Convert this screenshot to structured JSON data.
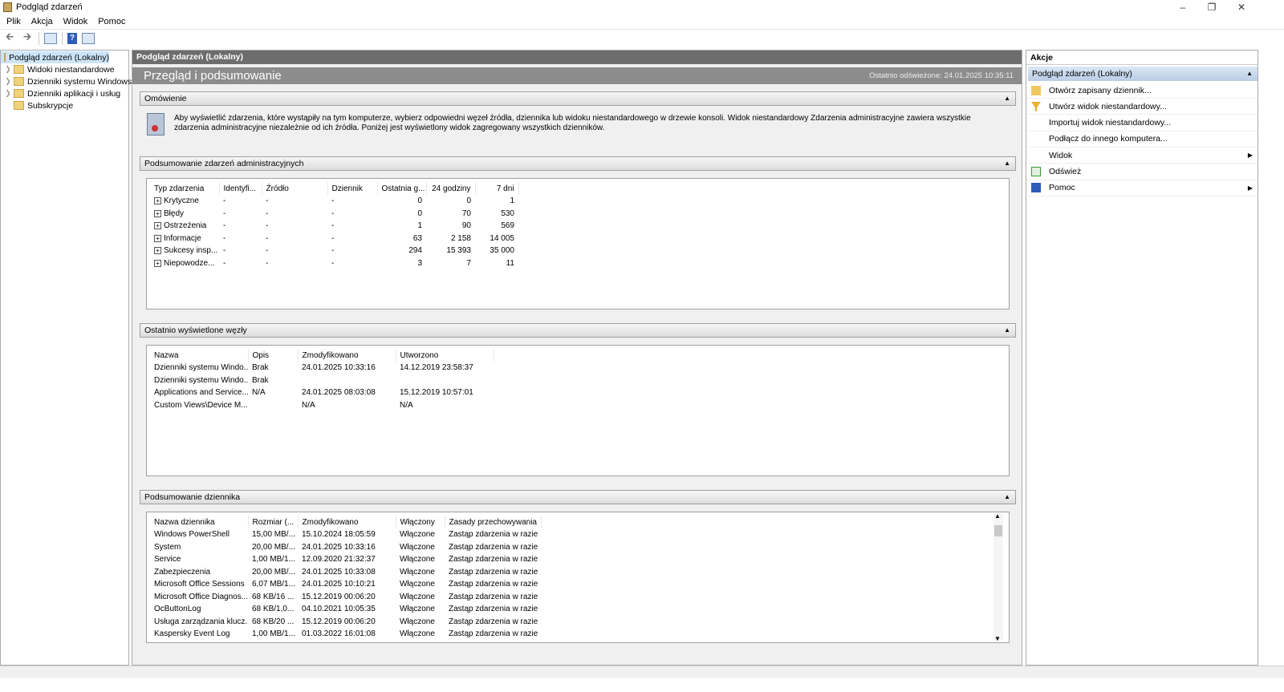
{
  "window": {
    "title": "Podgląd zdarzeń"
  },
  "menu": [
    "Plik",
    "Akcja",
    "Widok",
    "Pomoc"
  ],
  "tree": [
    {
      "label": "Podgląd zdarzeń (Lokalny)"
    },
    {
      "label": "Widoki niestandardowe"
    },
    {
      "label": "Dzienniki systemu Windows"
    },
    {
      "label": "Dzienniki aplikacji i usług"
    },
    {
      "label": "Subskrypcje"
    }
  ],
  "center": {
    "header": "Podgląd zdarzeń (Lokalny)",
    "title": "Przegląd i podsumowanie",
    "refreshed": "Ostatnio odświeżone: 24.01.2025 10:35:11",
    "overview": {
      "title": "Omówienie",
      "text": "Aby wyświetlić zdarzenia, które wystąpiły na tym komputerze, wybierz odpowiedni węzeł źródła, dziennika lub widoku niestandardowego w drzewie konsoli. Widok niestandardowy Zdarzenia administracyjne zawiera wszystkie zdarzenia administracyjne niezależnie od ich źródła. Poniżej jest wyświetlony widok zagregowany wszystkich dzienników."
    },
    "admin": {
      "title": "Podsumowanie zdarzeń administracyjnych",
      "columns": [
        "Typ zdarzenia",
        "Identyfi...",
        "Źródło",
        "Dziennik",
        "Ostatnia g...",
        "24 godziny",
        "7 dni"
      ],
      "rows": [
        [
          "Krytyczne",
          "-",
          "-",
          "-",
          "0",
          "0",
          "1"
        ],
        [
          "Błędy",
          "-",
          "-",
          "-",
          "0",
          "70",
          "530"
        ],
        [
          "Ostrzeżenia",
          "-",
          "-",
          "-",
          "1",
          "90",
          "569"
        ],
        [
          "Informacje",
          "-",
          "-",
          "-",
          "63",
          "2 158",
          "14 005"
        ],
        [
          "Sukcesy insp...",
          "-",
          "-",
          "-",
          "294",
          "15 393",
          "35 000"
        ],
        [
          "Niepowodze...",
          "-",
          "-",
          "-",
          "3",
          "7",
          "11"
        ]
      ]
    },
    "recent": {
      "title": "Ostatnio wyświetlone węzły",
      "columns": [
        "Nazwa",
        "Opis",
        "Zmodyfikowano",
        "Utworzono"
      ],
      "rows": [
        [
          "Dzienniki systemu Windo...",
          "Brak",
          "24.01.2025 10:33:16",
          "14.12.2019 23:58:37"
        ],
        [
          "Dzienniki systemu Windo...",
          "Brak",
          "",
          ""
        ],
        [
          "Applications and Service...",
          "N/A",
          "24.01.2025 08:03:08",
          "15.12.2019 10:57:01"
        ],
        [
          "Custom Views\\Device M...",
          "",
          "N/A",
          "N/A"
        ]
      ]
    },
    "logs": {
      "title": "Podsumowanie dziennika",
      "columns": [
        "Nazwa dziennika",
        "Rozmiar (...",
        "Zmodyfikowano",
        "Włączony",
        "Zasady przechowywania"
      ],
      "rows": [
        [
          "Windows PowerShell",
          "15,00 MB/...",
          "15.10.2024 18:05:59",
          "Włączone",
          "Zastąp zdarzenia w razie ..."
        ],
        [
          "System",
          "20,00 MB/...",
          "24.01.2025 10:33:16",
          "Włączone",
          "Zastąp zdarzenia w razie ..."
        ],
        [
          "Service",
          "1,00 MB/1...",
          "12.09.2020 21:32:37",
          "Włączone",
          "Zastąp zdarzenia w razie ..."
        ],
        [
          "Zabezpieczenia",
          "20,00 MB/...",
          "24.01.2025 10:33:08",
          "Włączone",
          "Zastąp zdarzenia w razie ..."
        ],
        [
          "Microsoft Office Sessions",
          "6,07 MB/1...",
          "24.01.2025 10:10:21",
          "Włączone",
          "Zastąp zdarzenia w razie ..."
        ],
        [
          "Microsoft Office Diagnos...",
          "68 KB/16 ...",
          "15.12.2019 00:06:20",
          "Włączone",
          "Zastąp zdarzenia w razie ..."
        ],
        [
          "OcButtonLog",
          "68 KB/1,0...",
          "04.10.2021 10:05:35",
          "Włączone",
          "Zastąp zdarzenia w razie ..."
        ],
        [
          "Usługa zarządzania klucz...",
          "68 KB/20 ...",
          "15.12.2019 00:06:20",
          "Włączone",
          "Zastąp zdarzenia w razie ..."
        ],
        [
          "Kaspersky Event Log",
          "1,00 MB/1...",
          "01.03.2022 16:01:08",
          "Włączone",
          "Zastąp zdarzenia w razie ..."
        ]
      ]
    }
  },
  "actions": {
    "title": "Akcje",
    "section": "Podgląd zdarzeń (Lokalny)",
    "items": [
      {
        "label": "Otwórz zapisany dziennik...",
        "icon": "open-folder-icon"
      },
      {
        "label": "Utwórz widok niestandardowy...",
        "icon": "filter-icon"
      },
      {
        "label": "Importuj widok niestandardowy...",
        "icon": ""
      },
      {
        "label": "Podłącz do innego komputera...",
        "icon": ""
      },
      {
        "label": "Widok",
        "icon": "",
        "submenu": true
      },
      {
        "label": "Odśwież",
        "icon": "refresh-icon"
      },
      {
        "label": "Pomoc",
        "icon": "help-icon",
        "submenu": true
      }
    ]
  }
}
